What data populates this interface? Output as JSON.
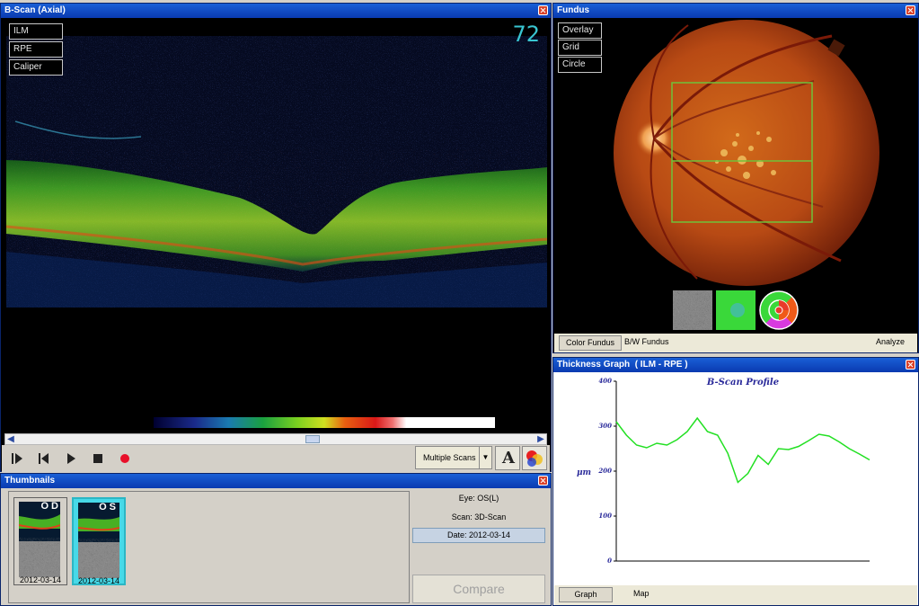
{
  "bscan": {
    "title": "B-Scan (Axial)",
    "overlay_buttons": [
      "ILM",
      "RPE",
      "Caliper"
    ],
    "scan_number": "72",
    "multi_scans_label": "Multiple Scans",
    "text_tool_label": "A"
  },
  "fundus": {
    "title": "Fundus",
    "overlay_buttons": [
      "Overlay",
      "Grid",
      "Circle"
    ],
    "tabs": [
      "Color Fundus",
      "B/W Fundus"
    ],
    "analyze_label": "Analyze"
  },
  "thickness": {
    "title": "Thickness Graph  ( ILM - RPE )",
    "tabs": [
      "Graph",
      "Map"
    ]
  },
  "thumbnails": {
    "title": "Thumbnails",
    "items": [
      {
        "eye": "OD",
        "date": "2012-03-14",
        "selected": false
      },
      {
        "eye": "OS",
        "date": "2012-03-14",
        "selected": true
      }
    ],
    "eye_info": "Eye: OS(L)",
    "scan_info": "Scan: 3D-Scan",
    "date_info": "Date: 2012-03-14",
    "compare_label": "Compare"
  },
  "chart_data": {
    "type": "line",
    "title": "B-Scan Profile",
    "xlabel": "",
    "ylabel": "μm",
    "ylim": [
      0,
      400
    ],
    "yticks": [
      "0",
      "100",
      "200",
      "300",
      "400"
    ],
    "x": [
      0,
      4,
      8,
      12,
      16,
      20,
      24,
      28,
      32,
      36,
      40,
      44,
      48,
      52,
      56,
      60,
      64,
      68,
      72,
      76,
      80,
      84,
      88,
      92,
      96,
      100
    ],
    "series": [
      {
        "values": [
          310,
          280,
          258,
          252,
          262,
          258,
          270,
          288,
          318,
          288,
          280,
          240,
          175,
          195,
          235,
          215,
          250,
          248,
          255,
          268,
          282,
          278,
          265,
          250,
          238,
          225
        ]
      }
    ],
    "color": "#22e022"
  }
}
